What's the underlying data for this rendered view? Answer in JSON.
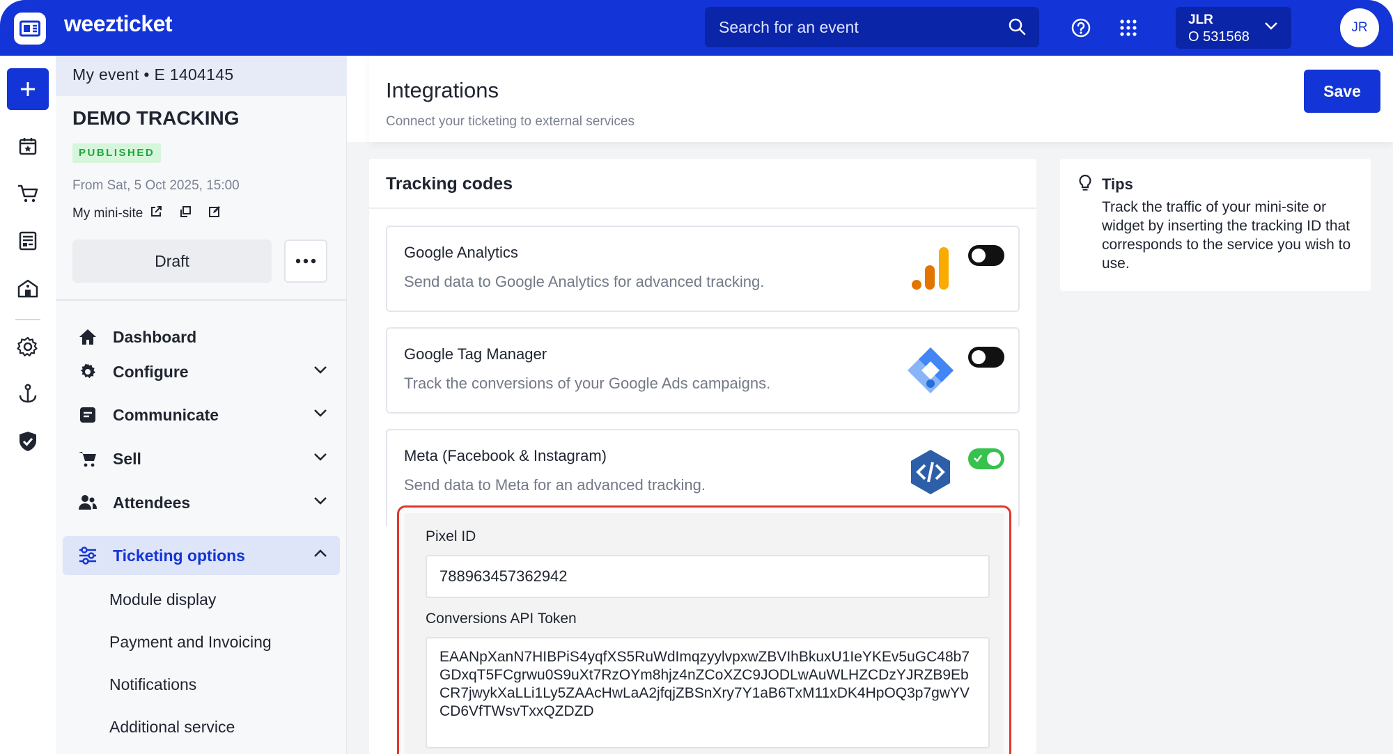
{
  "app": {
    "brand": "weezticket",
    "search_placeholder": "Search for an event",
    "account": {
      "code": "JLR",
      "number": "O 531568"
    },
    "avatar_initials": "JR"
  },
  "event": {
    "header": "My event • E 1404145",
    "title": "DEMO TRACKING",
    "status": "PUBLISHED",
    "date": "From Sat, 5 Oct 2025, 15:00",
    "minisite_label": "My mini-site",
    "draft_label": "Draft"
  },
  "nav": {
    "items": [
      {
        "label": "Dashboard",
        "icon": "home-icon"
      },
      {
        "label": "Configure",
        "icon": "gear-icon"
      },
      {
        "label": "Communicate",
        "icon": "message-icon"
      },
      {
        "label": "Sell",
        "icon": "cart-icon"
      },
      {
        "label": "Attendees",
        "icon": "users-icon"
      },
      {
        "label": "Ticketing options",
        "icon": "sliders-icon",
        "active": true
      }
    ],
    "sub_items": [
      "Module display",
      "Payment and Invoicing",
      "Notifications",
      "Additional service"
    ]
  },
  "page": {
    "title": "Integrations",
    "subtitle": "Connect your ticketing to external services",
    "save_label": "Save"
  },
  "tracking": {
    "title": "Tracking codes",
    "integrations": [
      {
        "name": "Google Analytics",
        "description": "Send data to Google Analytics for advanced tracking.",
        "enabled": false,
        "logo": "google-analytics-logo"
      },
      {
        "name": "Google Tag Manager",
        "description": "Track the conversions of your Google Ads campaigns.",
        "enabled": false,
        "logo": "google-tag-manager-logo"
      },
      {
        "name": "Meta (Facebook & Instagram)",
        "description": "Send data to Meta for an advanced tracking.",
        "enabled": true,
        "logo": "code-icon"
      }
    ],
    "meta_settings": {
      "pixel_label": "Pixel ID",
      "pixel_value": "788963457362942",
      "token_label": "Conversions API Token",
      "token_value": "EAANpXanN7HIBPiS4yqfXS5RuWdImqzyylvpxwZBVIhBkuxU1IeYKEv5uGC48b7GDxqT5FCgrwu0S9uXt7RzOYm8hjz4nZCoXZC9JODLwAuWLHZCDzYJRZB9EbCR7jwykXaLLi1Ly5ZAAcHwLaA2jfqjZBSnXry7Y1aB6TxM11xDK4HpOQ3p7gwYVCD6VfTWsvTxxQZDZD"
    }
  },
  "tips": {
    "title": "Tips",
    "text": "Track the traffic of your mini-site or widget by inserting the tracking ID that corresponds to the service you wish to use."
  },
  "colors": {
    "brand_blue": "#1334d6",
    "published_green": "#21a43c",
    "toggle_on": "#36c24d",
    "highlight_red": "#e0372c"
  }
}
